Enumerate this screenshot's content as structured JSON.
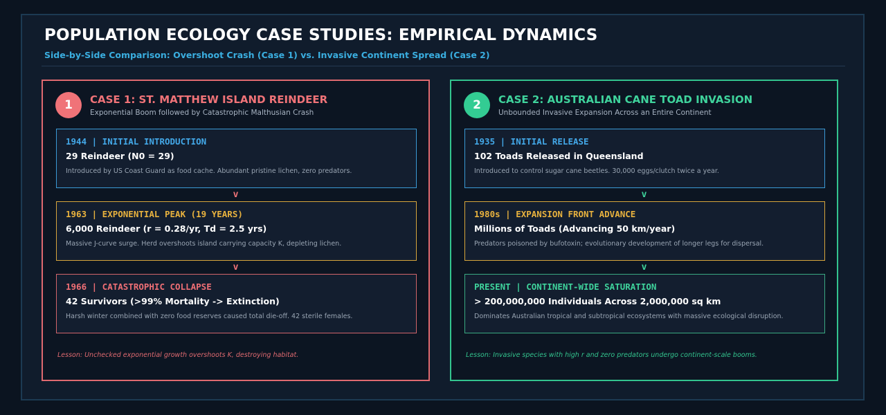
{
  "header": {
    "title": "POPULATION ECOLOGY CASE STUDIES: EMPIRICAL DYNAMICS",
    "subtitle": "Side-by-Side Comparison: Overshoot Crash (Case 1) vs. Invasive Continent Spread (Case 2)"
  },
  "case1": {
    "number": "1",
    "title": "CASE 1: ST. MATTHEW ISLAND REINDEER",
    "subtitle": "Exponential Boom followed by Catastrophic Malthusian Crash",
    "steps": [
      {
        "head": "1944 | INITIAL INTRODUCTION",
        "main": "29 Reindeer (N0 = 29)",
        "desc": "Introduced by US Coast Guard as food cache. Abundant pristine lichen, zero predators."
      },
      {
        "head": "1963 | EXPONENTIAL PEAK (19 YEARS)",
        "main": "6,000 Reindeer (r = 0.28/yr, Td = 2.5 yrs)",
        "desc": "Massive J-curve surge. Herd overshoots island carrying capacity K, depleting lichen."
      },
      {
        "head": "1966 | CATASTROPHIC COLLAPSE",
        "main": "42 Survivors (>99% Mortality -> Extinction)",
        "desc": "Harsh winter combined with zero food reserves caused total die-off. 42 sterile females."
      }
    ],
    "arrow": "v",
    "lesson": "Lesson: Unchecked exponential growth overshoots K, destroying habitat."
  },
  "case2": {
    "number": "2",
    "title": "CASE 2: AUSTRALIAN CANE TOAD INVASION",
    "subtitle": "Unbounded Invasive Expansion Across an Entire Continent",
    "steps": [
      {
        "head": "1935 | INITIAL RELEASE",
        "main": "102 Toads Released in Queensland",
        "desc": "Introduced to control sugar cane beetles. 30,000 eggs/clutch twice a year."
      },
      {
        "head": "1980s | EXPANSION FRONT ADVANCE",
        "main": "Millions of Toads (Advancing 50 km/year)",
        "desc": "Predators poisoned by bufotoxin; evolutionary development of longer legs for dispersal."
      },
      {
        "head": "PRESENT | CONTINENT-WIDE SATURATION",
        "main": "> 200,000,000 Individuals Across 2,000,000 sq km",
        "desc": "Dominates Australian tropical and subtropical ecosystems with massive ecological disruption."
      }
    ],
    "arrow": "v",
    "lesson": "Lesson: Invasive species with high r and zero predators undergo continent-scale booms."
  },
  "colors": {
    "case1_accent": "#f07378",
    "case2_accent": "#33cc93",
    "blue": "#43a8e8",
    "amber": "#e8b23e"
  }
}
